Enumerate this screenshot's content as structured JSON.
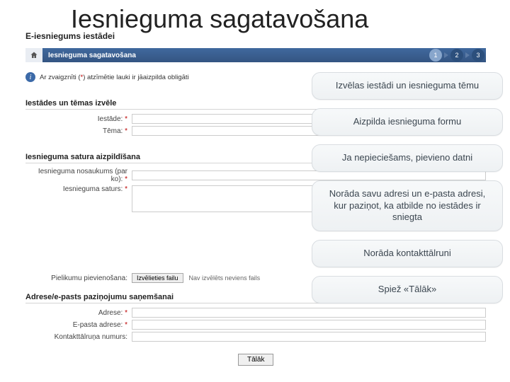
{
  "title": "Iesnieguma sagatavošana",
  "subheader": "E-iesniegums iestādei",
  "breadcrumb": "Iesnieguma sagatavošana",
  "steps": [
    "1",
    "2",
    "3"
  ],
  "notice": {
    "prefix": "Ar zvaigznīti (",
    "star": "*",
    "suffix": ") atzīmētie lauki ir jāaizpilda obligāti"
  },
  "sections": {
    "s1": "Iestādes un tēmas izvēle",
    "s2": "Iesnieguma satura aizpildīšana",
    "s3": "Adrese/e-pasts paziņojumu saņemšanai"
  },
  "labels": {
    "iestade": "Iestāde:",
    "tema": "Tēma:",
    "nosauk": "Iesnieguma nosaukums (par ko):",
    "saturs": "Iesnieguma saturs:",
    "piev": "Pielikumu pievienošana:",
    "adrese": "Adrese:",
    "epasts": "E-pasta adrese:",
    "tel": "Kontakttālruņa numurs:"
  },
  "file": {
    "button": "Izvēlieties failu",
    "status": "Nav izvēlēts neviens fails"
  },
  "next": "Tālāk",
  "callouts": {
    "c1": "Izvēlas iestādi un iesnieguma tēmu",
    "c2": "Aizpilda iesnieguma formu",
    "c3": "Ja nepieciešams, pievieno datni",
    "c4": "Norāda savu adresi un e-pasta adresi, kur paziņot, ka atbilde no iestādes ir sniegta",
    "c5": "Norāda kontakttālruni",
    "c6": "Spiež «Tālāk»"
  }
}
